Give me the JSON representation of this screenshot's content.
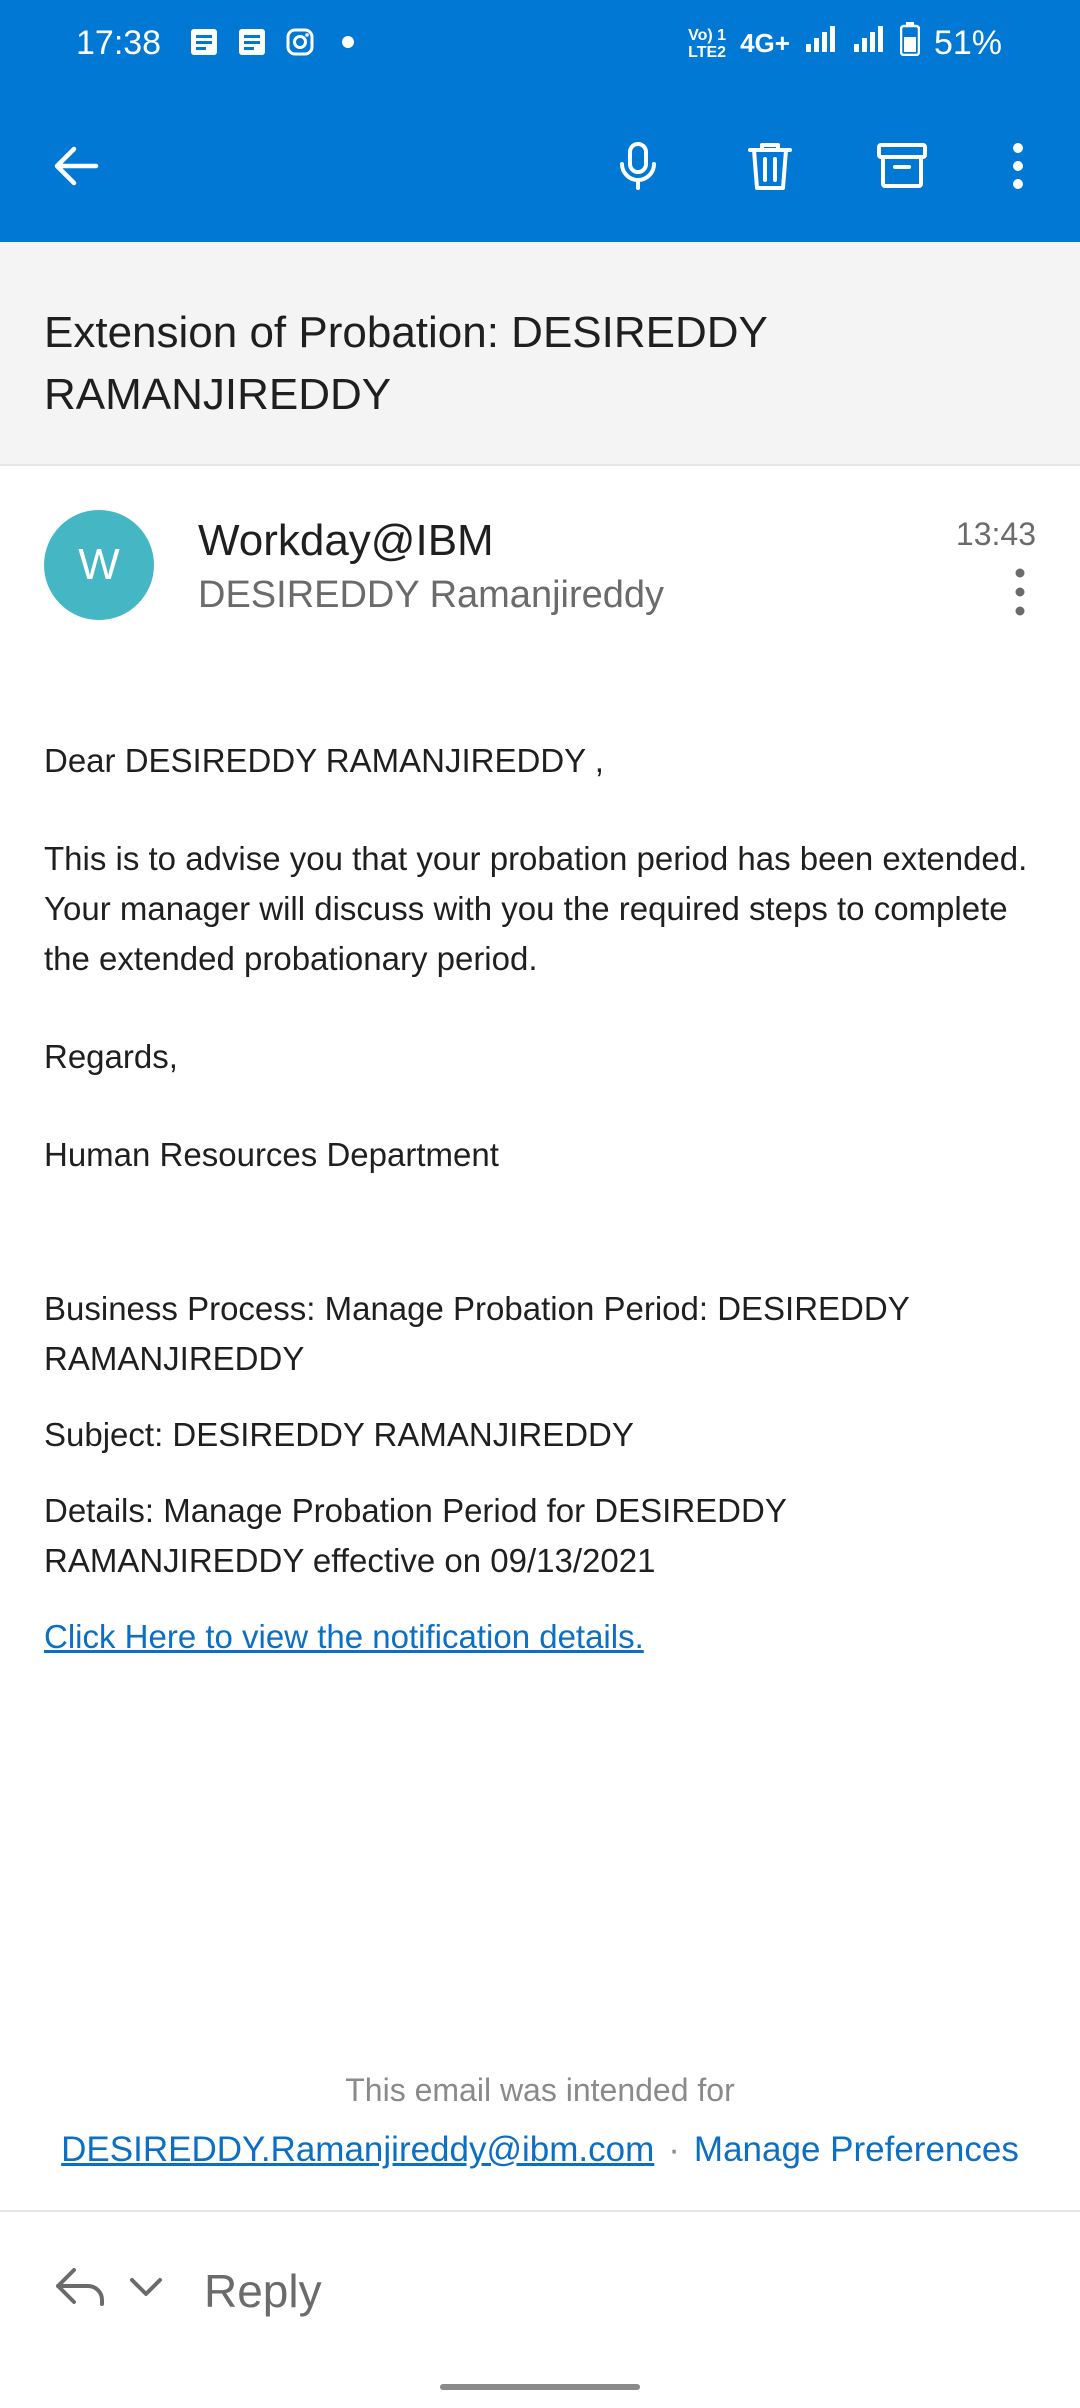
{
  "status_bar": {
    "time": "17:38",
    "network_top": "Vo) 1",
    "network_bottom": "LTE2",
    "network_type": "4G+",
    "battery": "51%"
  },
  "app_bar": {
    "back": "back-arrow-icon",
    "actions": [
      "microphone-icon",
      "delete-icon",
      "archive-icon",
      "more-vertical-icon"
    ]
  },
  "email": {
    "subject": "Extension of Probation: DESIREDDY RAMANJIREDDY",
    "sender": {
      "initial": "W",
      "name": "Workday@IBM",
      "recipient": "DESIREDDY Ramanjireddy",
      "time": "13:43",
      "avatar_color": "#45b7c4"
    },
    "body": {
      "greeting": "Dear DESIREDDY RAMANJIREDDY ,",
      "paragraph": "This is to advise you that your probation period has been extended. Your manager will discuss with you the required steps to complete the extended probationary period.",
      "regards": "Regards,",
      "signature": "Human Resources Department",
      "business_process": "Business Process: Manage Probation Period: DESIREDDY RAMANJIREDDY",
      "subject_line": "Subject: DESIREDDY RAMANJIREDDY",
      "details": "Details: Manage Probation Period for DESIREDDY RAMANJIREDDY effective on 09/13/2021",
      "link": "Click Here to view the notification details."
    },
    "footer": {
      "note": "This email was intended for",
      "email": "DESIREDDY.Ramanjireddy@ibm.com",
      "separator": "·",
      "manage": "Manage Preferences"
    }
  },
  "reply_bar": {
    "label": "Reply"
  },
  "colors": {
    "accent": "#0078d4",
    "link": "#0b6fc4"
  }
}
